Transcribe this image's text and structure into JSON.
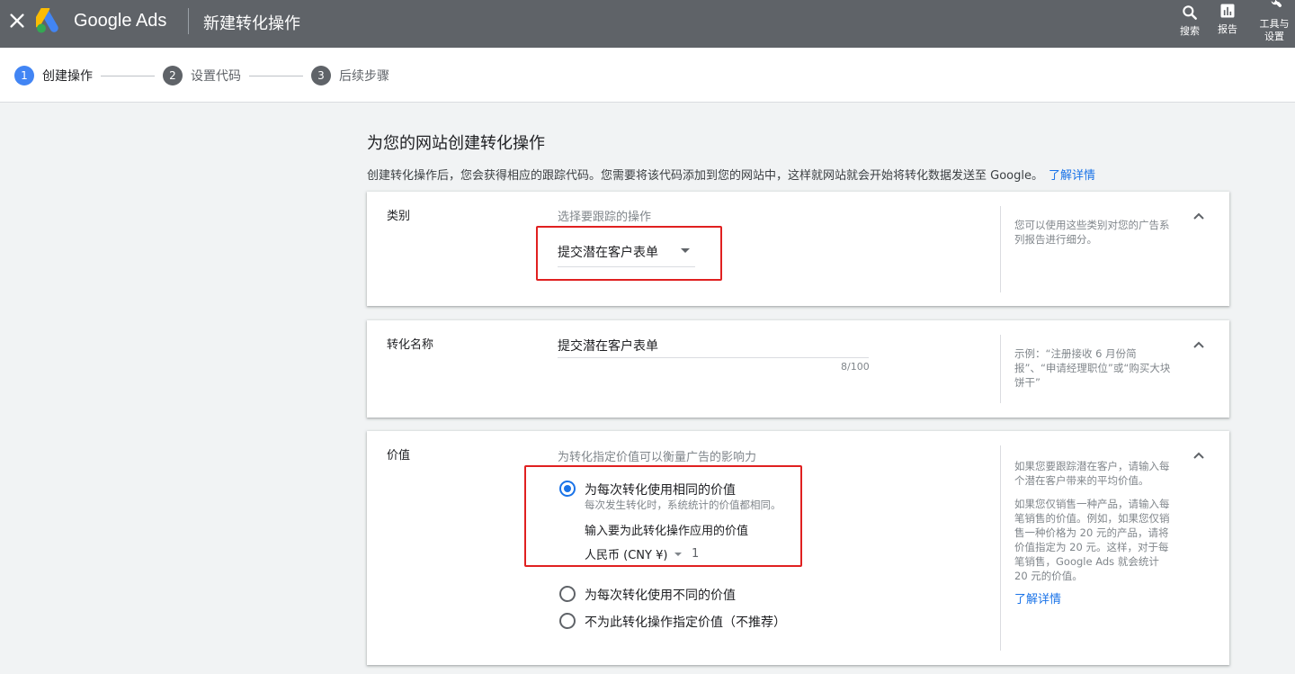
{
  "app": {
    "brand": "Google Ads",
    "title": "新建转化操作"
  },
  "top_actions": {
    "search": "搜索",
    "reports": "报告",
    "tools_line1": "工具与",
    "tools_line2": "设置"
  },
  "steps": [
    {
      "num": "1",
      "label": "创建操作"
    },
    {
      "num": "2",
      "label": "设置代码"
    },
    {
      "num": "3",
      "label": "后续步骤"
    }
  ],
  "main": {
    "heading": "为您的网站创建转化操作",
    "intro": "创建转化操作后，您会获得相应的跟踪代码。您需要将该代码添加到您的网站中，这样就网站就会开始将转化数据发送至 Google。",
    "learn_more": "了解详情"
  },
  "category_card": {
    "label": "类别",
    "hint": "选择要跟踪的操作",
    "selected": "提交潜在客户表单",
    "help": "您可以使用这些类别对您的广告系列报告进行细分。"
  },
  "name_card": {
    "label": "转化名称",
    "value": "提交潜在客户表单",
    "count": "8/100",
    "help": "示例：“注册接收 6 月份简报”、“申请经理职位”或“购买大块饼干”"
  },
  "value_card": {
    "label": "价值",
    "hint": "为转化指定价值可以衡量广告的影响力",
    "options": [
      {
        "label": "为每次转化使用相同的价值",
        "sub": "每次发生转化时，系统统计的价值都相同。",
        "selected": true
      },
      {
        "label": "为每次转化使用不同的价值",
        "selected": false
      },
      {
        "label": "不为此转化操作指定价值（不推荐）",
        "selected": false
      }
    ],
    "enter_value_label": "输入要为此转化操作应用的价值",
    "currency": "人民币 (CNY ¥)",
    "amount": "1",
    "help_p1": "如果您要跟踪潜在客户，请输入每个潜在客户带来的平均价值。",
    "help_p2": "如果您仅销售一种产品，请输入每笔销售的价值。例如，如果您仅销售一种价格为 20 元的产品，请将价值指定为 20 元。这样，对于每笔销售，Google Ads 就会统计 20 元的价值。",
    "help_link": "了解详情"
  },
  "colors": {
    "topbar": "#5f6368",
    "accent": "#1a73e8",
    "active_step": "#4285f4",
    "highlight": "#e02020"
  }
}
